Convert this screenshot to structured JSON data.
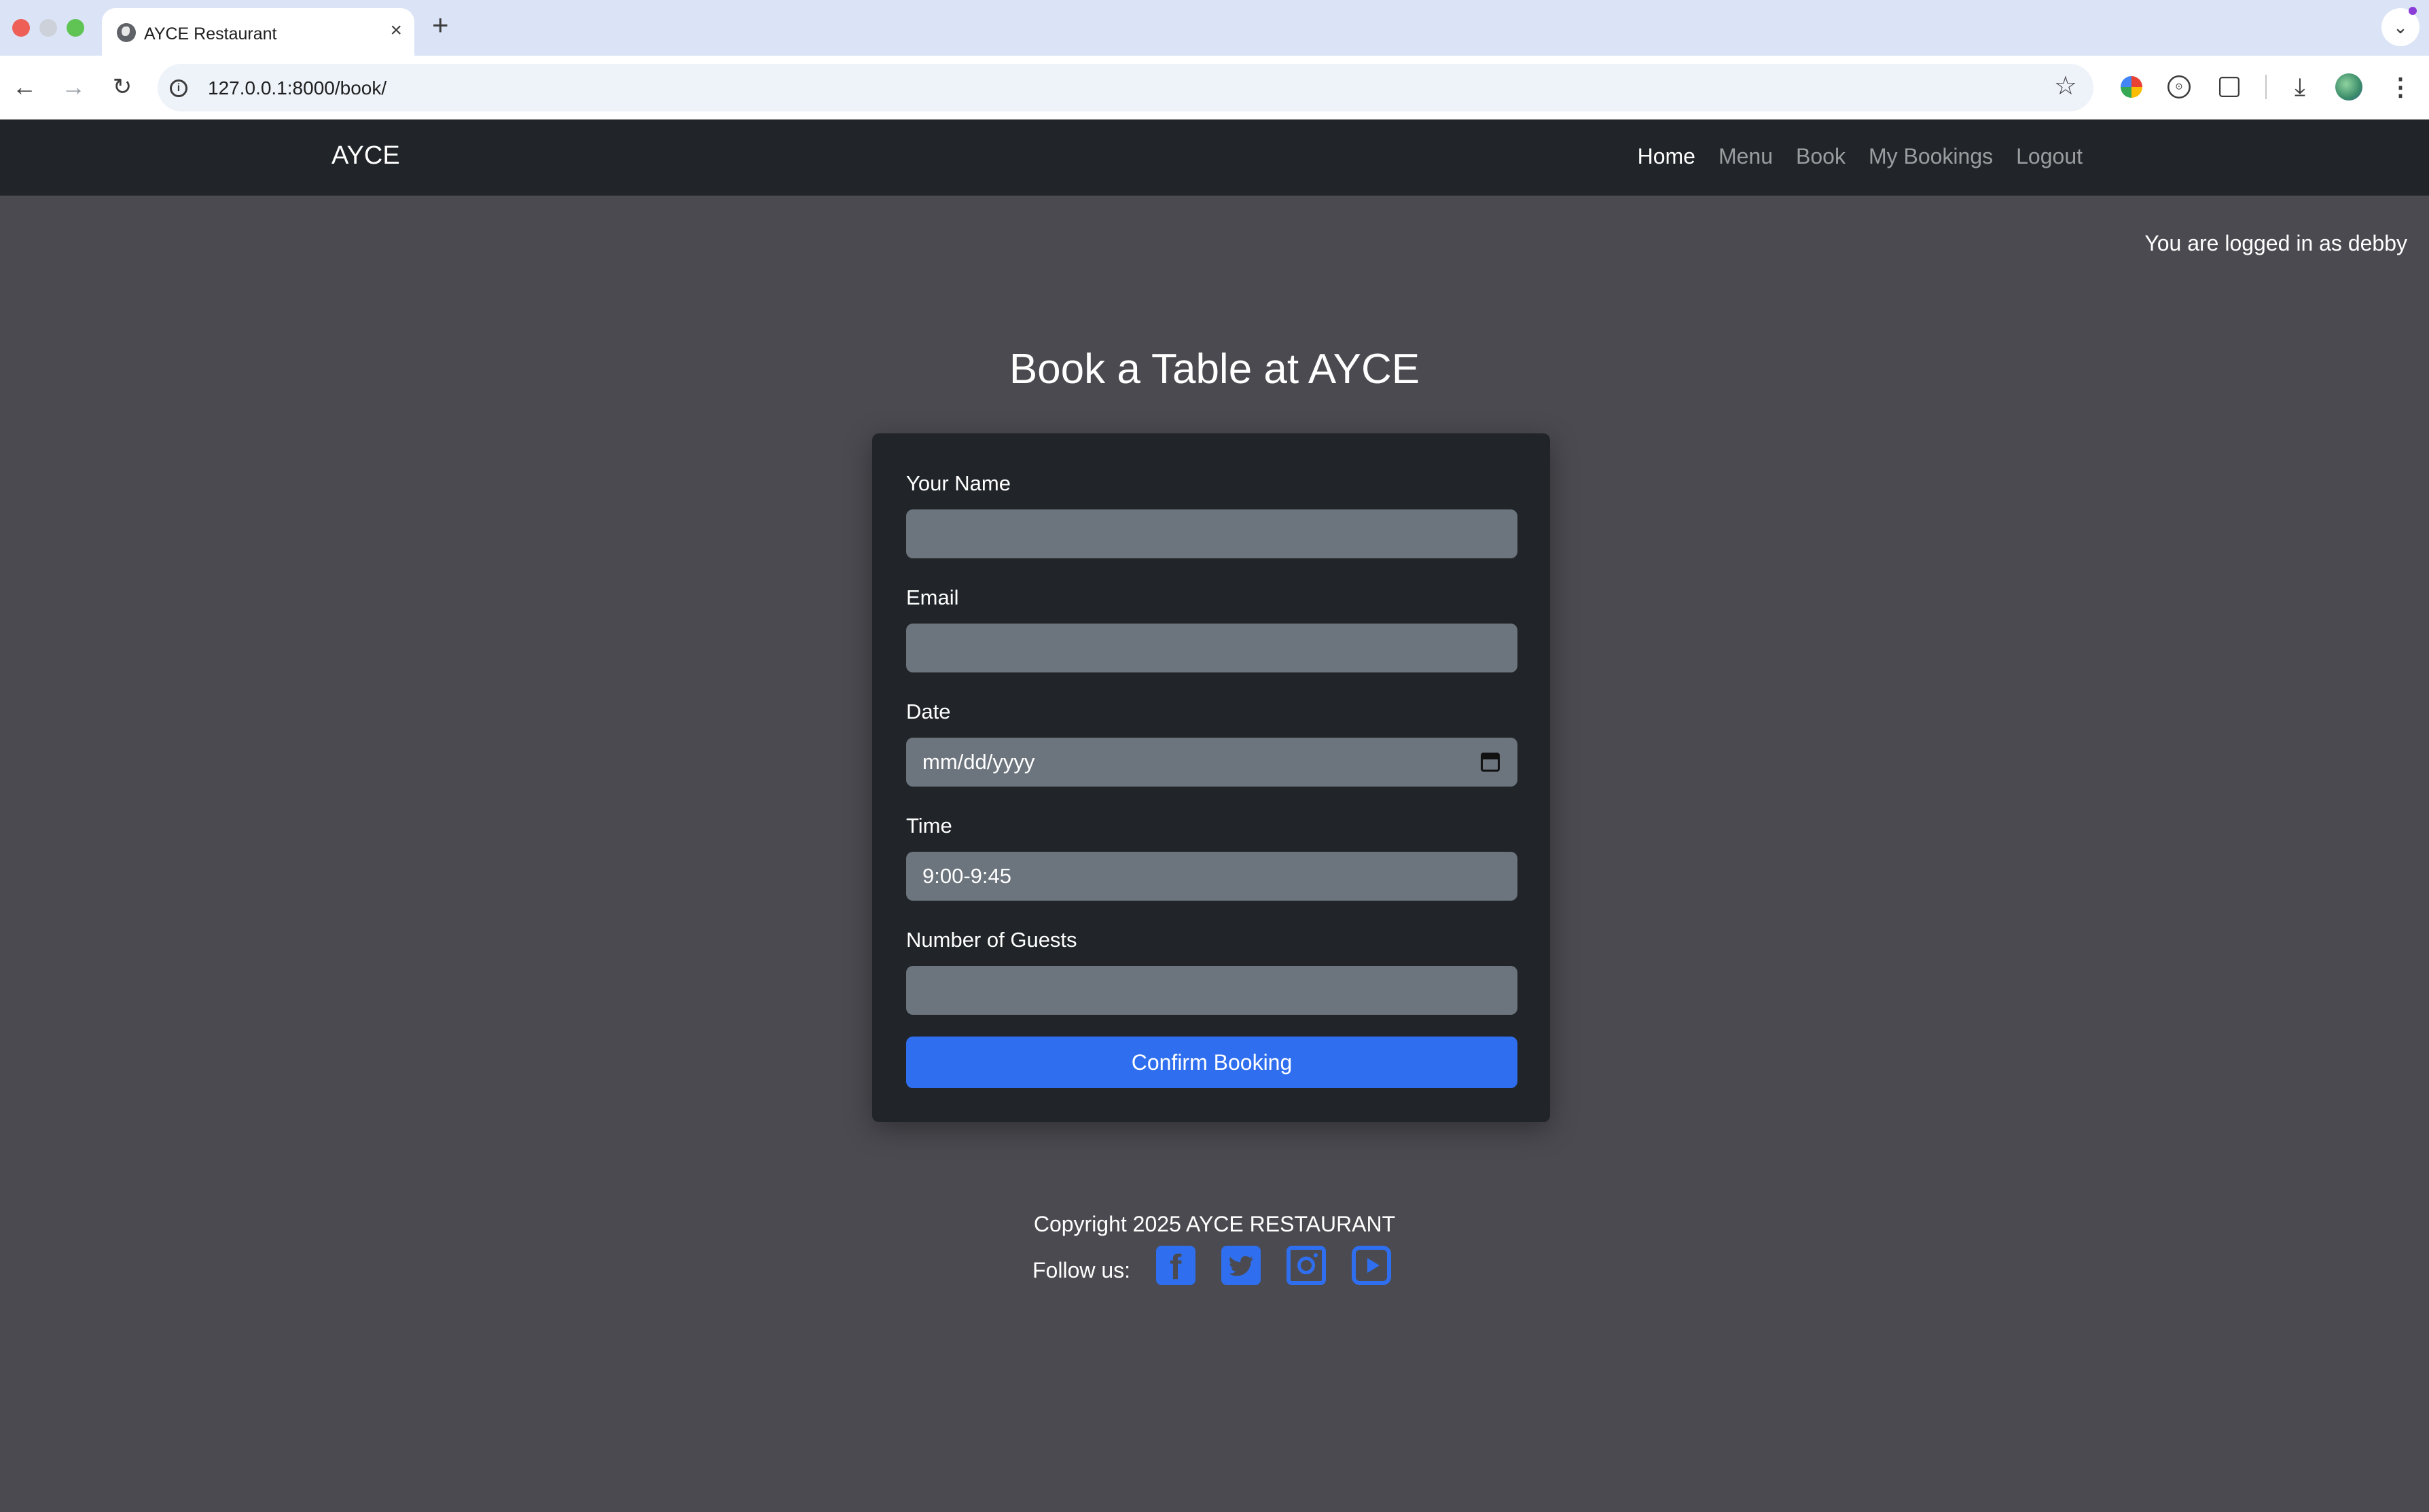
{
  "browser": {
    "tab_title": "AYCE Restaurant",
    "tab_close": "×",
    "new_tab": "+",
    "url": "127.0.0.1:8000/book/",
    "icons": [
      "back-arrow-icon",
      "forward-arrow-icon",
      "reload-icon",
      "info-icon",
      "star-icon",
      "colorwheel-extension-icon",
      "extension-icon",
      "puzzle-icon",
      "download-icon",
      "profile-avatar",
      "kebab-menu-icon"
    ]
  },
  "navbar": {
    "brand": "AYCE",
    "links": [
      "Home",
      "Menu",
      "Book",
      "My Bookings",
      "Logout"
    ],
    "active": "Home"
  },
  "status": {
    "logged_in": "You are logged in as debby"
  },
  "page": {
    "title": "Book a Table at AYCE"
  },
  "form": {
    "name_label": "Your Name",
    "name_value": "",
    "email_label": "Email",
    "email_value": "",
    "date_label": "Date",
    "date_placeholder": "mm/dd/yyyy",
    "time_label": "Time",
    "time_value": "9:00-9:45",
    "guests_label": "Number of Guests",
    "guests_value": "",
    "submit_label": "Confirm Booking"
  },
  "footer": {
    "copyright": "Copyright 2025 AYCE RESTAURANT",
    "follow_label": "Follow us:",
    "social": [
      "facebook-icon",
      "twitter-icon",
      "instagram-icon",
      "youtube-icon"
    ]
  },
  "colors": {
    "page_bg": "#4a4a50",
    "navbar_bg": "#212529",
    "card_bg": "#212529",
    "input_bg": "#6c757d",
    "accent": "#2f6fef"
  }
}
